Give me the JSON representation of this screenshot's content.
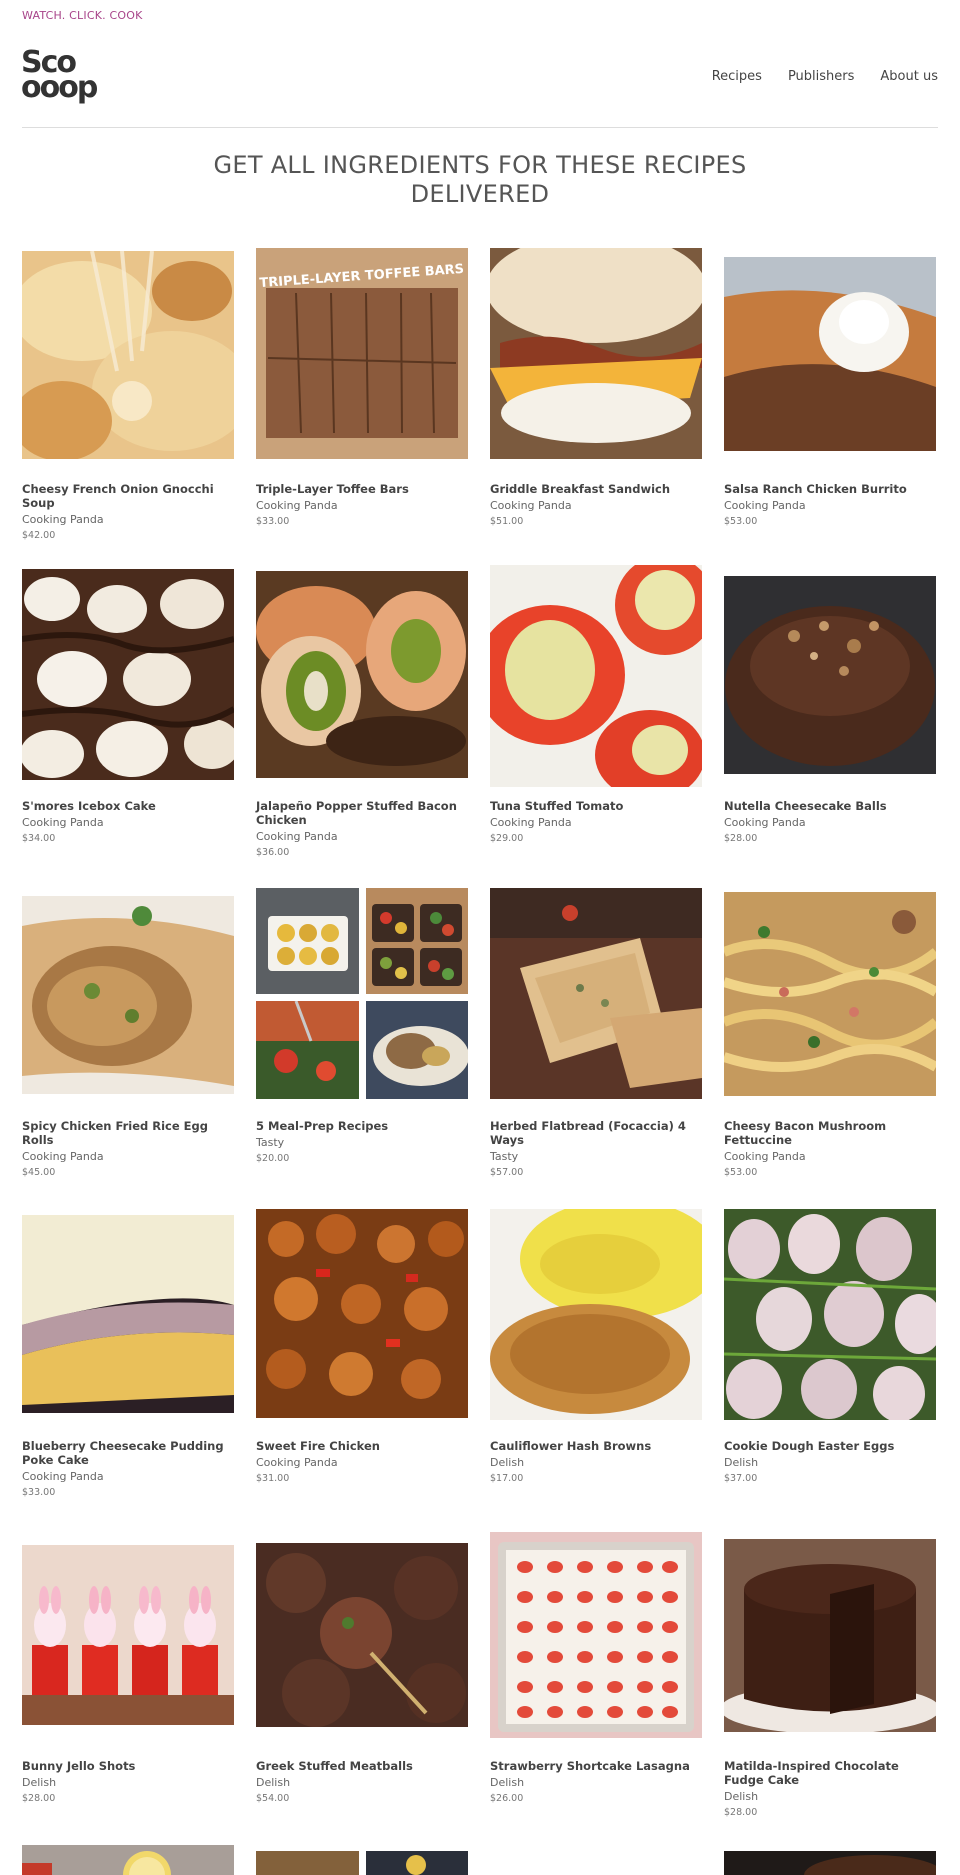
{
  "header": {
    "tagline": "WATCH. CLICK. COOK",
    "logo_line1": "Sco",
    "logo_line2": "ooop",
    "nav": [
      "Recipes",
      "Publishers",
      "About us"
    ]
  },
  "headline_line1": "GET ALL INGREDIENTS FOR THESE RECIPES",
  "headline_line2": "DELIVERED",
  "photo_captions": {
    "toffee": "TRIPLE-LAYER TOFFEE BARS"
  },
  "recipes": [
    {
      "title": "Cheesy French Onion Gnocchi Soup",
      "publisher": "Cooking Panda",
      "price": "$42.00",
      "photo": "cheesy-gnocchi"
    },
    {
      "title": "Triple-Layer Toffee Bars",
      "publisher": "Cooking Panda",
      "price": "$33.00",
      "photo": "toffee-bars"
    },
    {
      "title": "Griddle Breakfast Sandwich",
      "publisher": "Cooking Panda",
      "price": "$51.00",
      "photo": "breakfast-sandwich"
    },
    {
      "title": "Salsa Ranch Chicken Burrito",
      "publisher": "Cooking Panda",
      "price": "$53.00",
      "photo": "burrito"
    },
    {
      "title": "S'mores Icebox Cake",
      "publisher": "Cooking Panda",
      "price": "$34.00",
      "photo": "smores"
    },
    {
      "title": "Jalapeño Popper Stuffed Bacon Chicken",
      "publisher": "Cooking Panda",
      "price": "$36.00",
      "photo": "jalapeno-chicken"
    },
    {
      "title": "Tuna Stuffed Tomato",
      "publisher": "Cooking Panda",
      "price": "$29.00",
      "photo": "tuna-tomato"
    },
    {
      "title": "Nutella Cheesecake Balls",
      "publisher": "Cooking Panda",
      "price": "$28.00",
      "photo": "nutella-balls"
    },
    {
      "title": "Spicy Chicken Fried Rice Egg Rolls",
      "publisher": "Cooking Panda",
      "price": "$45.00",
      "photo": "egg-rolls"
    },
    {
      "title": "5 Meal-Prep Recipes",
      "publisher": "Tasty",
      "price": "$20.00",
      "photo": "meal-prep"
    },
    {
      "title": "Herbed Flatbread (Focaccia) 4 Ways",
      "publisher": "Tasty",
      "price": "$57.00",
      "photo": "focaccia"
    },
    {
      "title": "Cheesy Bacon Mushroom Fettuccine",
      "publisher": "Cooking Panda",
      "price": "$53.00",
      "photo": "fettuccine"
    },
    {
      "title": "Blueberry Cheesecake Pudding Poke Cake",
      "publisher": "Cooking Panda",
      "price": "$33.00",
      "photo": "poke-cake"
    },
    {
      "title": "Sweet Fire Chicken",
      "publisher": "Cooking Panda",
      "price": "$31.00",
      "photo": "sweet-fire-chicken"
    },
    {
      "title": "Cauliflower Hash Browns",
      "publisher": "Delish",
      "price": "$17.00",
      "photo": "hash-browns"
    },
    {
      "title": "Cookie Dough Easter Eggs",
      "publisher": "Delish",
      "price": "$37.00",
      "photo": "easter-eggs"
    },
    {
      "title": "Bunny Jello Shots",
      "publisher": "Delish",
      "price": "$28.00",
      "photo": "jello-shots"
    },
    {
      "title": "Greek Stuffed Meatballs",
      "publisher": "Delish",
      "price": "$54.00",
      "photo": "meatballs"
    },
    {
      "title": "Strawberry Shortcake Lasagna",
      "publisher": "Delish",
      "price": "$26.00",
      "photo": "strawberry-lasagna"
    },
    {
      "title": "Matilda-Inspired Chocolate Fudge Cake",
      "publisher": "Delish",
      "price": "$28.00",
      "photo": "fudge-cake"
    }
  ]
}
